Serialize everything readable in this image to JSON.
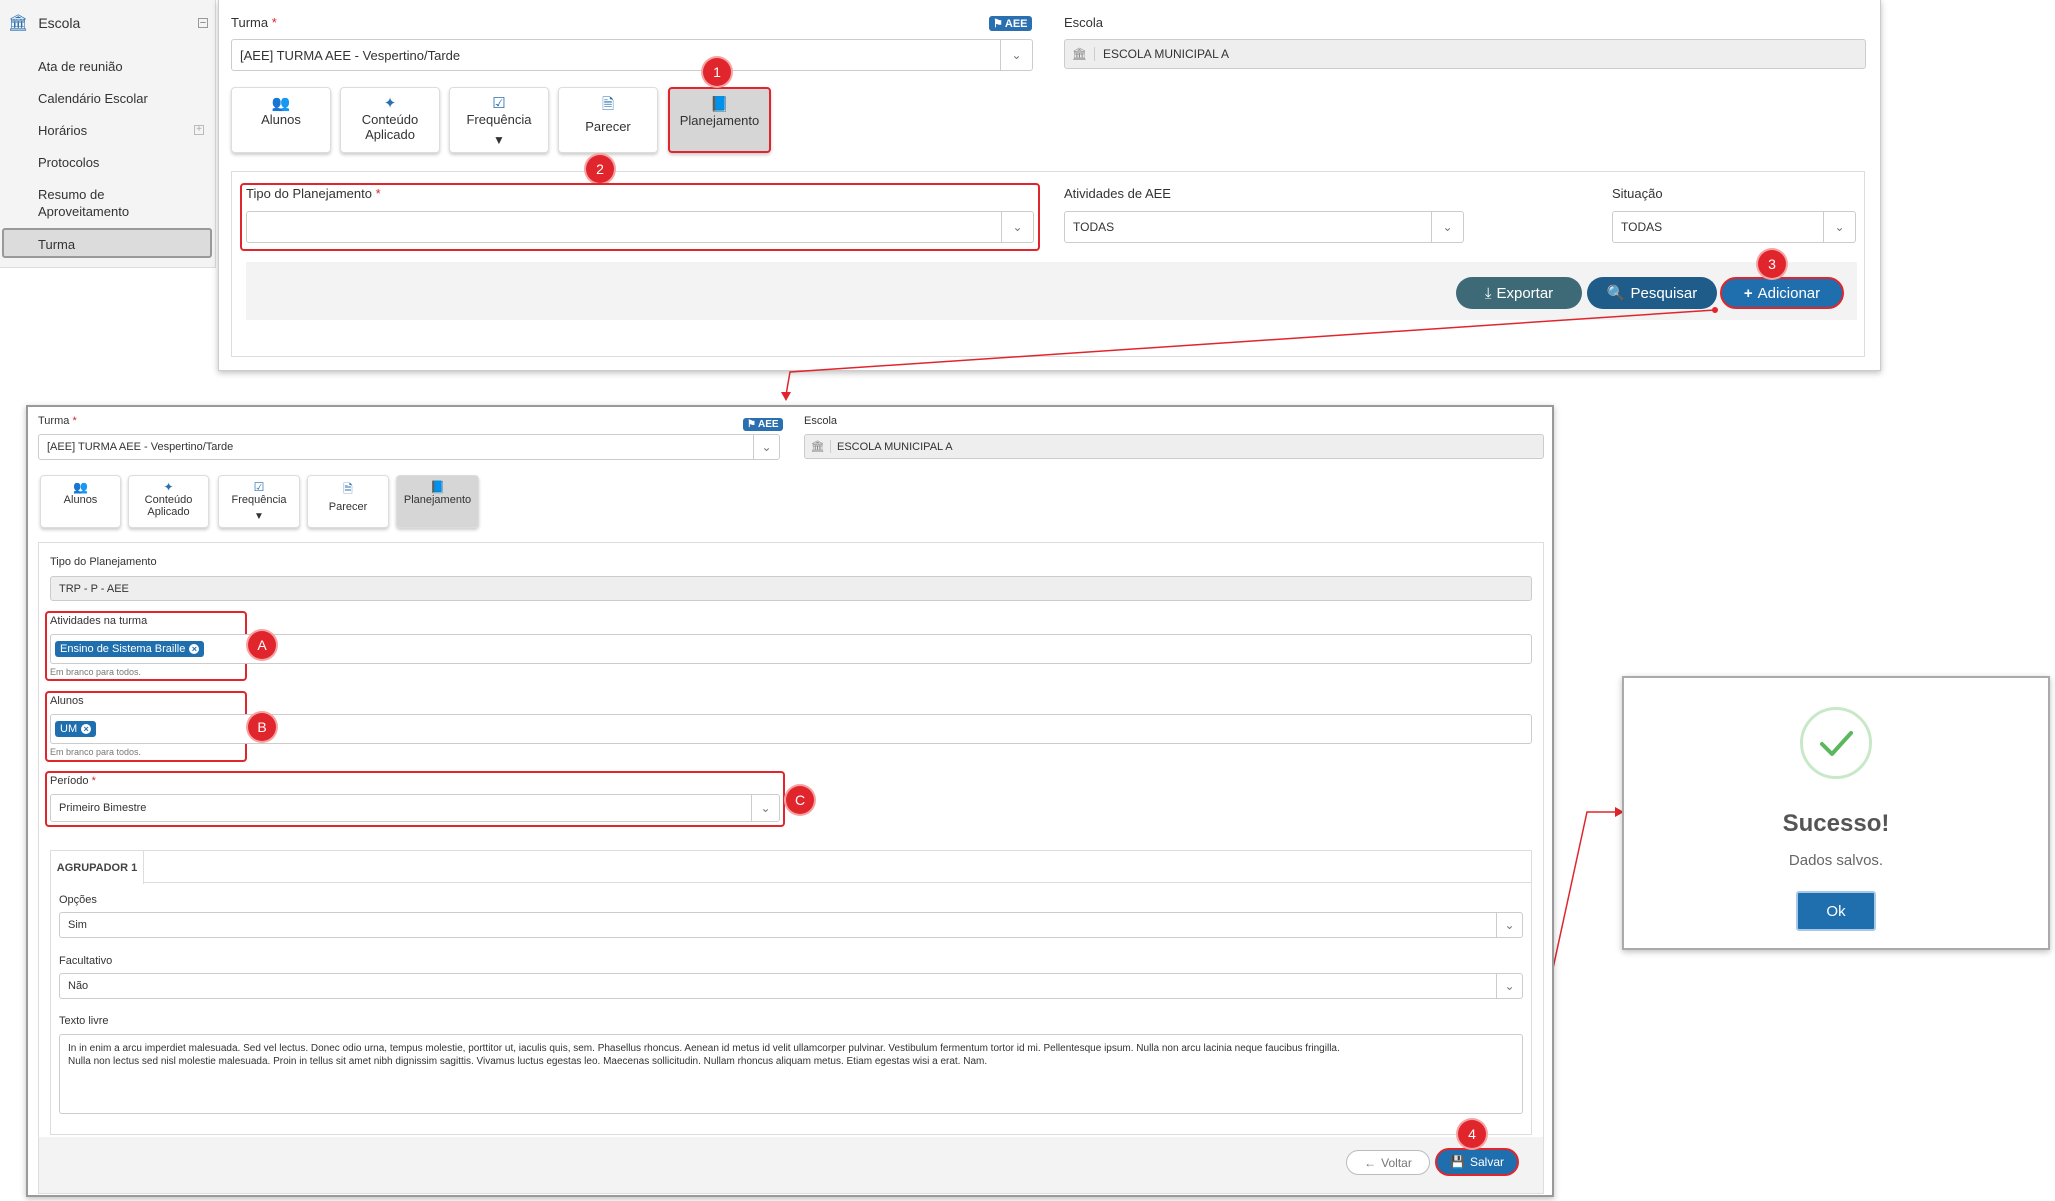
{
  "sidebar": {
    "title": "Escola",
    "items": [
      {
        "label": "Ata de reunião"
      },
      {
        "label": "Calendário Escolar"
      },
      {
        "label": "Horários"
      },
      {
        "label": "Protocolos"
      },
      {
        "label": "Resumo de Aproveitamento"
      },
      {
        "label": "Turma"
      }
    ]
  },
  "top": {
    "turma_label": "Turma",
    "required_mark": "*",
    "aee_badge": "AEE",
    "turma_value": "[AEE]  TURMA AEE - Vespertino/Tarde",
    "escola_label": "Escola",
    "escola_value": "ESCOLA MUNICIPAL A",
    "tiles": [
      {
        "label": "Alunos"
      },
      {
        "label": "Conteúdo Aplicado"
      },
      {
        "label": "Frequência"
      },
      {
        "label": "Parecer"
      },
      {
        "label": "Planejamento"
      }
    ],
    "tipo_label": "Tipo do Planejamento",
    "tipo_value": "",
    "atividades_label": "Atividades de AEE",
    "atividades_value": "TODAS",
    "situacao_label": "Situação",
    "situacao_value": "TODAS",
    "buttons": {
      "exportar": "Exportar",
      "pesquisar": "Pesquisar",
      "adicionar": "Adicionar"
    }
  },
  "form": {
    "turma_label": "Turma",
    "aee_badge": "AEE",
    "turma_value": "[AEE]  TURMA AEE - Vespertino/Tarde",
    "escola_label": "Escola",
    "escola_value": "ESCOLA MUNICIPAL A",
    "tiles": [
      {
        "label": "Alunos"
      },
      {
        "label": "Conteúdo Aplicado"
      },
      {
        "label": "Frequência"
      },
      {
        "label": "Parecer"
      },
      {
        "label": "Planejamento"
      }
    ],
    "tipo_label": "Tipo do Planejamento",
    "tipo_value": "TRP - P - AEE",
    "atividades_label": "Atividades na turma",
    "atividades_chip": "Ensino de Sistema Braille",
    "atividades_hint": "Em branco para todos.",
    "alunos_label": "Alunos",
    "alunos_chip": "UM",
    "alunos_hint": "Em branco para todos.",
    "periodo_label": "Período",
    "periodo_value": "Primeiro Bimestre",
    "tab_label": "AGRUPADOR 1",
    "opcoes_label": "Opções",
    "opcoes_value": "Sim",
    "facultativo_label": "Facultativo",
    "facultativo_value": "Não",
    "texto_label": "Texto livre",
    "texto_line1": "In in enim a arcu imperdiet malesuada. Sed vel lectus. Donec odio urna, tempus molestie, porttitor ut, iaculis quis, sem. Phasellus rhoncus. Aenean id metus id velit ullamcorper pulvinar. Vestibulum fermentum tortor id mi. Pellentesque ipsum. Nulla non arcu lacinia neque faucibus fringilla.",
    "texto_line2": "Nulla non lectus sed nisl molestie malesuada. Proin in tellus sit amet nibh dignissim sagittis. Vivamus luctus egestas leo. Maecenas sollicitudin. Nullam rhoncus aliquam metus. Etiam egestas wisi a erat. Nam.",
    "voltar": "Voltar",
    "salvar": "Salvar"
  },
  "dialog": {
    "title": "Sucesso!",
    "message": "Dados salvos.",
    "ok": "Ok"
  },
  "markers": {
    "m1": "1",
    "m2": "2",
    "m3": "3",
    "m4": "4",
    "mA": "A",
    "mB": "B",
    "mC": "C"
  },
  "colors": {
    "primary": "#1f6fae",
    "annotation": "#e0262c",
    "exportar": "#3e6a78",
    "success": "#5cb85c"
  }
}
